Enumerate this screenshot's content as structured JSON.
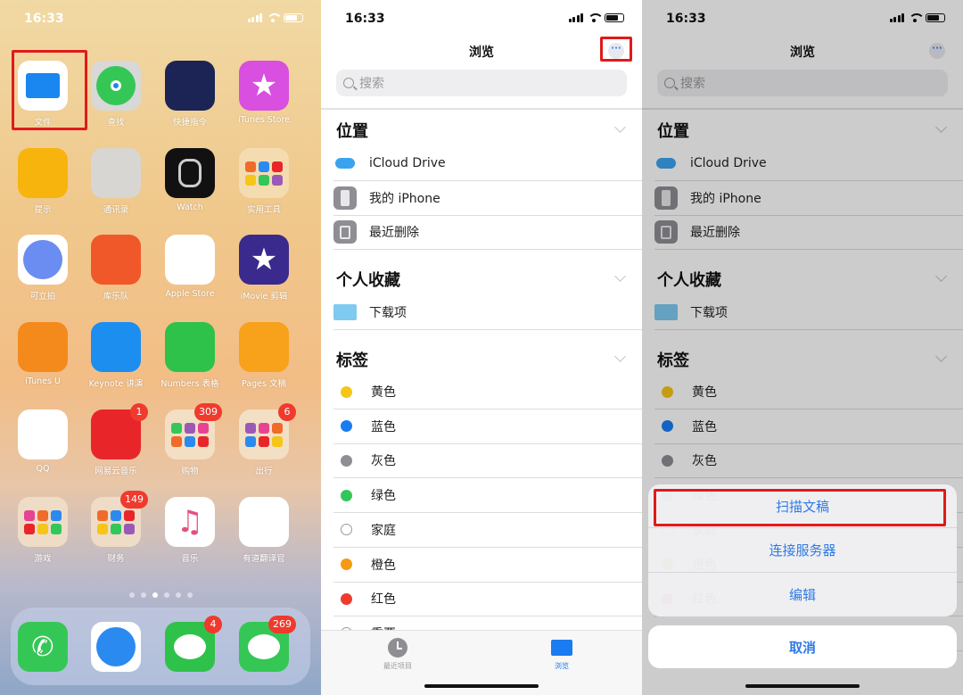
{
  "status_time": "16:33",
  "home": {
    "apps": [
      {
        "label": "文件",
        "icon": "files-icon",
        "bg": "#ffffff"
      },
      {
        "label": "查找",
        "icon": "find-my-icon",
        "bg": "#d8d8d8"
      },
      {
        "label": "快捷指令",
        "icon": "shortcuts-icon",
        "bg": "#1c2456"
      },
      {
        "label": "iTunes Store",
        "icon": "itunes-store-icon",
        "bg": "#d94fe0"
      },
      {
        "label": "提示",
        "icon": "tips-icon",
        "bg": "#f7b40d"
      },
      {
        "label": "通讯录",
        "icon": "contacts-icon",
        "bg": "#d8d6d2"
      },
      {
        "label": "Watch",
        "icon": "watch-icon",
        "bg": "#111111"
      },
      {
        "label": "实用工具",
        "icon": "utilities-folder-icon",
        "bg": "#f4dcb0"
      },
      {
        "label": "可立拍",
        "icon": "clips-icon",
        "bg": "#ffffff"
      },
      {
        "label": "库乐队",
        "icon": "garageband-icon",
        "bg": "#f0582a"
      },
      {
        "label": "Apple Store",
        "icon": "apple-store-icon",
        "bg": "#ffffff"
      },
      {
        "label": "iMovie 剪辑",
        "icon": "imovie-icon",
        "bg": "#3a2a8e"
      },
      {
        "label": "iTunes U",
        "icon": "itunes-u-icon",
        "bg": "#f48a1c"
      },
      {
        "label": "Keynote 讲演",
        "icon": "keynote-icon",
        "bg": "#1b8ef0"
      },
      {
        "label": "Numbers 表格",
        "icon": "numbers-icon",
        "bg": "#2fc24a"
      },
      {
        "label": "Pages 文稿",
        "icon": "pages-icon",
        "bg": "#f7a21a"
      },
      {
        "label": "QQ",
        "icon": "qq-icon",
        "bg": "#ffffff"
      },
      {
        "label": "网易云音乐",
        "icon": "netease-music-icon",
        "bg": "#e8262a",
        "badge": "1"
      },
      {
        "label": "购物",
        "icon": "shopping-folder-icon",
        "bg": "#f2dfc4",
        "badge": "309"
      },
      {
        "label": "出行",
        "icon": "travel-folder-icon",
        "bg": "#f2dfc4",
        "badge": "6"
      },
      {
        "label": "游戏",
        "icon": "games-folder-icon",
        "bg": "#eedcc6"
      },
      {
        "label": "财务",
        "icon": "finance-folder-icon",
        "bg": "#eedcc6",
        "badge": "149"
      },
      {
        "label": "音乐",
        "icon": "music-icon",
        "bg": "#ffffff"
      },
      {
        "label": "有道翻译官",
        "icon": "youdao-translate-icon",
        "bg": "#ffffff"
      }
    ],
    "page_count": 6,
    "current_page": 3,
    "dock": [
      {
        "label": "电话",
        "icon": "phone-icon",
        "bg": "#35c756"
      },
      {
        "label": "Safari",
        "icon": "safari-icon",
        "bg": "#ffffff"
      },
      {
        "label": "微信",
        "icon": "wechat-icon",
        "bg": "#2fc24a",
        "badge": "4"
      },
      {
        "label": "信息",
        "icon": "messages-icon",
        "bg": "#35c756",
        "badge": "269"
      }
    ]
  },
  "files": {
    "title": "浏览",
    "more_label": "···",
    "search_placeholder": "搜索",
    "sections": {
      "locations": {
        "title": "位置",
        "items": [
          "iCloud Drive",
          "我的 iPhone",
          "最近删除"
        ]
      },
      "favorites": {
        "title": "个人收藏",
        "items": [
          "下载项"
        ]
      },
      "tags": {
        "title": "标签",
        "items": [
          {
            "label": "黄色",
            "color": "#f5c518"
          },
          {
            "label": "蓝色",
            "color": "#1a7cf0"
          },
          {
            "label": "灰色",
            "color": "#8e8e93"
          },
          {
            "label": "绿色",
            "color": "#33c759"
          },
          {
            "label": "家庭",
            "color": "#ffffff"
          },
          {
            "label": "橙色",
            "color": "#f59a14"
          },
          {
            "label": "红色",
            "color": "#f03a2e"
          },
          {
            "label": "重要",
            "color": "#ffffff"
          }
        ]
      }
    },
    "tabs": [
      {
        "label": "最近项目",
        "active": false
      },
      {
        "label": "浏览",
        "active": true
      }
    ]
  },
  "action_sheet": {
    "actions": [
      "扫描文稿",
      "连接服务器",
      "编辑"
    ],
    "cancel": "取消"
  },
  "colors": {
    "accent": "#2e7ae6",
    "highlight": "#e01a1a"
  }
}
